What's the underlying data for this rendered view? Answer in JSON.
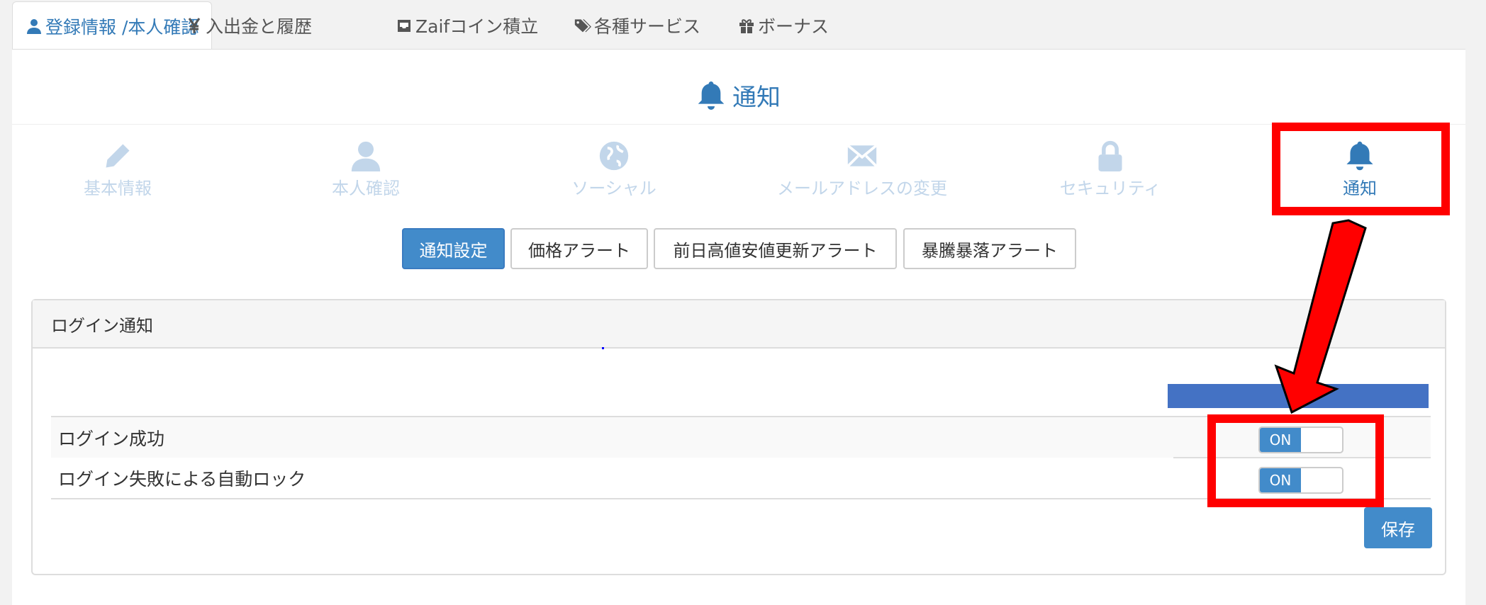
{
  "top_tabs": [
    {
      "label": "登録情報 /本人確認",
      "icon": "user-icon",
      "active": true
    },
    {
      "label": "入出金と履歴",
      "icon": "yen-icon",
      "active": false
    },
    {
      "label": "Zaifコイン積立",
      "icon": "inbox-icon",
      "active": false
    },
    {
      "label": "各種サービス",
      "icon": "tags-icon",
      "active": false
    },
    {
      "label": "ボーナス",
      "icon": "gift-icon",
      "active": false
    }
  ],
  "page_title": "通知",
  "page_title_icon": "bell-icon",
  "sub_nav": [
    {
      "label": "基本情報",
      "icon": "pencil-icon",
      "active": false
    },
    {
      "label": "本人確認",
      "icon": "user-icon",
      "active": false
    },
    {
      "label": "ソーシャル",
      "icon": "globe-icon",
      "active": false
    },
    {
      "label": "メールアドレスの変更",
      "icon": "envelope-icon",
      "active": false
    },
    {
      "label": "セキュリティ",
      "icon": "lock-icon",
      "active": false
    },
    {
      "label": "通知",
      "icon": "bell-icon",
      "active": true
    }
  ],
  "button_group": [
    {
      "label": "通知設定",
      "active": true
    },
    {
      "label": "価格アラート",
      "active": false
    },
    {
      "label": "前日高値安値更新アラート",
      "active": false
    },
    {
      "label": "暴騰暴落アラート",
      "active": false
    }
  ],
  "panel": {
    "heading": "ログイン通知",
    "rows": [
      {
        "label": "ログイン成功",
        "toggle": "ON"
      },
      {
        "label": "ログイン失敗による自動ロック",
        "toggle": "ON"
      }
    ],
    "save_label": "保存"
  },
  "colors": {
    "accent": "#337ab7",
    "primary_button": "#428bca",
    "inactive_icon": "#c2d6ea",
    "annotation_red": "#ff0000",
    "annotation_blue_bar": "#4472c4"
  }
}
